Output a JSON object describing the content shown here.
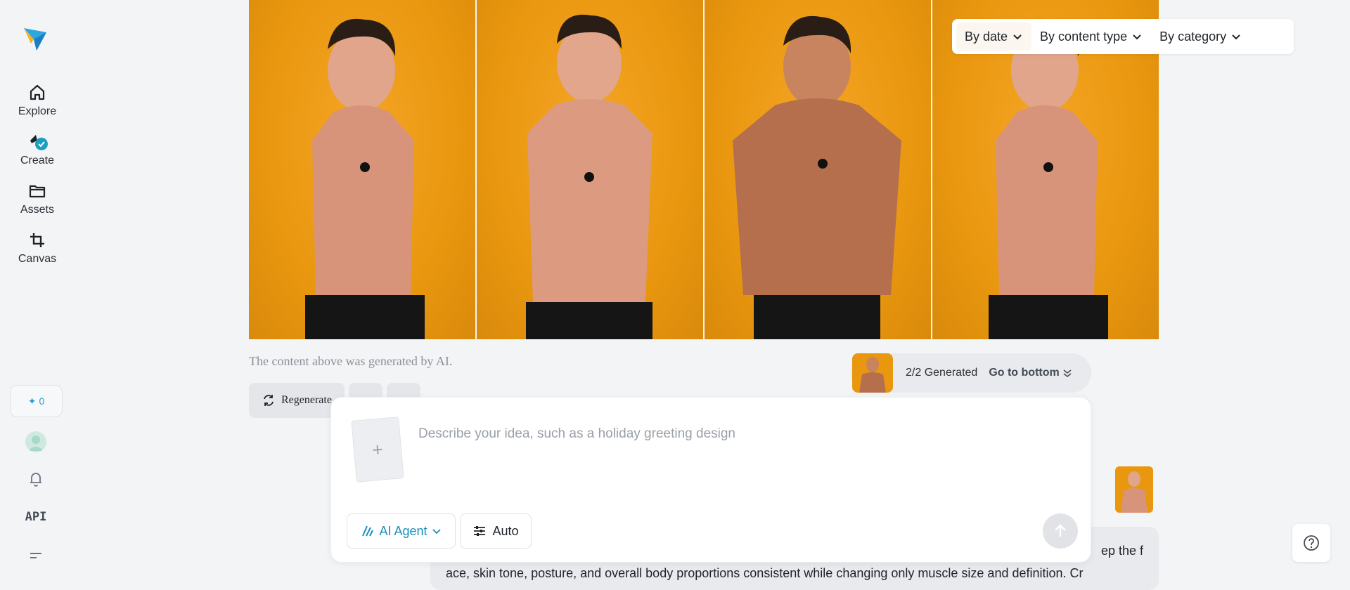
{
  "sidebar": {
    "items": [
      {
        "label": "Explore",
        "icon": "home-icon"
      },
      {
        "label": "Create",
        "icon": "create-sparkle-icon"
      },
      {
        "label": "Assets",
        "icon": "folder-icon"
      },
      {
        "label": "Canvas",
        "icon": "crop-icon"
      }
    ],
    "credits": "0",
    "api_label": "API"
  },
  "filters": [
    {
      "label": "By date"
    },
    {
      "label": "By content type"
    },
    {
      "label": "By category"
    }
  ],
  "gallery": {
    "ai_note": "The content above was generated by AI.",
    "images": [
      {
        "label": "generated-image-1"
      },
      {
        "label": "generated-image-2"
      },
      {
        "label": "generated-image-3"
      },
      {
        "label": "generated-image-4"
      }
    ]
  },
  "actions": {
    "regenerate_label": "Regenerate"
  },
  "generation_status": {
    "count": "2/2",
    "label": "Generated",
    "go_bottom": "Go to bottom"
  },
  "composer": {
    "placeholder": "Describe your idea, such as a holiday greeting design",
    "value": "",
    "upload_symbol": "+",
    "agent_label": "AI Agent",
    "mode_label": "Auto"
  },
  "chat": {
    "line1_tail": "ep the f",
    "line2": "ace, skin tone, posture, and overall body proportions consistent while changing only muscle size and definition. Cr"
  },
  "colors": {
    "accent": "#1a8fb9",
    "background": "#f3f4f6",
    "photo_bg": "#e9970f"
  }
}
